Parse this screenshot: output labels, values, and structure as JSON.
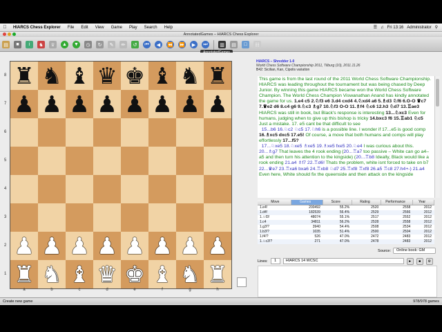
{
  "menubar": {
    "app_name": "HIARCS Chess Explorer",
    "items": [
      "File",
      "Edit",
      "View",
      "Game",
      "Play",
      "Search",
      "Help"
    ],
    "clock": "Fri 13:16",
    "user": "Administrator"
  },
  "window": {
    "title": "AnnotatedGames – HIARCS Chess Explorer"
  },
  "toolbar": {
    "tooltip": "AnnotatedGames"
  },
  "board": {
    "ranks": [
      "8",
      "7",
      "6",
      "5",
      "4",
      "3",
      "2",
      "1"
    ],
    "files": [
      "a",
      "b",
      "c",
      "d",
      "e",
      "f",
      "g",
      "h"
    ],
    "pieces": {
      "r8": [
        "♜",
        "♞",
        "♝",
        "♛",
        "♚",
        "♝",
        "♞",
        "♜"
      ],
      "r7": [
        "♟",
        "♟",
        "♟",
        "♟",
        "♟",
        "♟",
        "♟",
        "♟"
      ],
      "r2": [
        "♟",
        "♟",
        "♟",
        "♟",
        "♟",
        "♟",
        "♟",
        "♟"
      ],
      "r1": [
        "♜",
        "♞",
        "♝",
        "♛",
        "♚",
        "♝",
        "♞",
        "♜"
      ]
    }
  },
  "game": {
    "players": "HIARCS – Shredder   1-0",
    "event": "World Chess Software Championship 2011, Tilburg (10), 2011.11.26",
    "opening": "B42: Sicilian, Kan, Cipolis variation"
  },
  "notation": {
    "p1": "This game is from the last round of the 2011 World Chess Software Championship. HIARCS was leading throughout the tournament but was being chased by Deep Junior. By winning this game HIARCS became won the World Chess Software Champion. The World Chess Champion Viswanathan Anand has kindly annotated the game for us.",
    "m1": "1.e4 c5 2.♘f3 e6 3.d4 cxd4 4.♘xd4 a6 5.♗d3 ♘f6 6.O-O ♛c7 7.♛e2 d6 8.c4 g6 9.♘c3 ♗g7 10.♘f3 O-O 11.♗f4 ♘c6 12.h3 ♘d7 13.♖ae3",
    "c2": "HIARCS was still in book, but Black's response is interesting",
    "m2": "13...♘xc3",
    "c3": "Even for humans, judging when to give up this bishop is tricky",
    "m3": "14.bxc3 f6 15.♖ab1 ♘c5",
    "c4": "Just a mistake. 17. e5 cant be that difficult to see",
    "v1": "15...b6 16.♘c2 ♘c5 17.♘h6",
    "c5": "is a possible line. I wonder if 17...e5 is good comp",
    "m4": "16.♗xc5 dxc5 17.e5!",
    "c6": "Of course, a move that both humans and comps will play effortlessly",
    "m5": "17...f5?",
    "v2": "17...♘xe5 18.♘xe5 ♗xe5 19.♗xe5 fxe5 20.♘e4",
    "c7": "I was curious about this.",
    "v3": "20...♗g7",
    "c8": "That leaves the 4 rook ending (",
    "v4": "20...♖a7",
    "c9": "too passive – White can go a4–a5 and then turn his attention to the kingside) (",
    "v5": "20...♖b8",
    "c10": "Ideally, Black would like a rook ending",
    "v6": "21.a4 ♗f7 22.♖d6!",
    "c11": "Thats the problem, white isnt forced to take on b7",
    "v7": "22...♛e7 23.♖xa6 bxa6 24.♖xb8 ♘d7 25.♖xf8 ♖xf8 26.a5 ♖c8 27.h4+-) 21.a4",
    "c12": "Even here, White should fix the queenside and then attack on the kingside"
  },
  "book": {
    "headers": [
      "Move",
      "Games",
      "Score",
      "Rating",
      "Performance",
      "Year"
    ],
    "rows": [
      [
        "1.e4!",
        "200492",
        "55.2%",
        "2520",
        "2558",
        "2012"
      ],
      [
        "1.d4!",
        "182539",
        "56.4%",
        "2529",
        "2566",
        "2012"
      ],
      [
        "1.♘f3!",
        "48074",
        "55.1%",
        "2517",
        "2552",
        "2012"
      ],
      [
        "1.c4",
        "34811",
        "56.2%",
        "2528",
        "2558",
        "2012"
      ],
      [
        "1.g3!?",
        "3940",
        "54.4%",
        "2508",
        "2534",
        "2012"
      ],
      [
        "1.b3!?",
        "1035",
        "51.4%",
        "2500",
        "2504",
        "2012"
      ],
      [
        "1.f4!?",
        "526",
        "47.0%",
        "2472",
        "2483",
        "2012"
      ],
      [
        "1.♘c3!?",
        "271",
        "47.0%",
        "2478",
        "2483",
        "2012"
      ]
    ]
  },
  "source": {
    "label": "Source:",
    "value": "Online book: GM"
  },
  "lines": {
    "label": "Lines:",
    "count": "1",
    "engine": "HIARCS 14 WCSC"
  },
  "status": {
    "left": "Create new game",
    "right": "978/978 games"
  },
  "colors": {
    "light_square": "#f1d3a5",
    "dark_square": "#d49b5e",
    "comment": "#1a8a1a",
    "variation": "#3030c0"
  }
}
